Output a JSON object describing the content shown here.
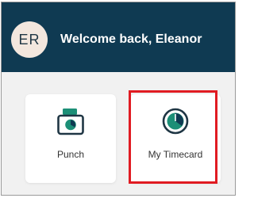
{
  "header": {
    "avatar_initials": "ER",
    "welcome_text": "Welcome back, Eleanor",
    "background_color": "#0f3a52"
  },
  "tiles": [
    {
      "label": "Punch",
      "icon": "punch-clock-icon"
    },
    {
      "label": "My Timecard",
      "icon": "timecard-clock-icon"
    }
  ],
  "colors": {
    "accent_teal": "#1c8f77",
    "highlight_red": "#e01b22"
  }
}
